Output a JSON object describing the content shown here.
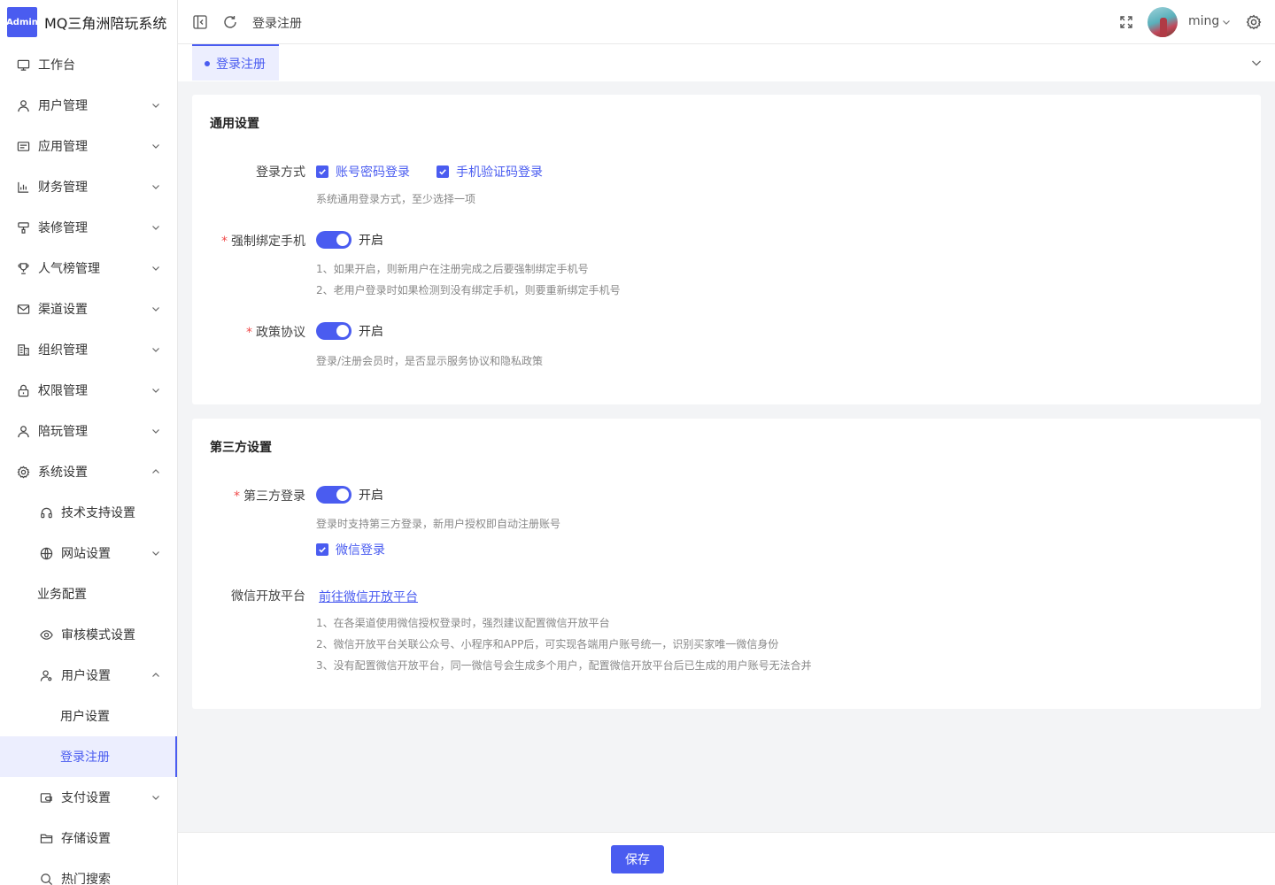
{
  "brand": {
    "logo_text": "Admin",
    "title": "MQ三角洲陪玩系统"
  },
  "sidebar": {
    "items": [
      {
        "label": "工作台",
        "icon": "monitor-icon"
      },
      {
        "label": "用户管理",
        "icon": "user-icon"
      },
      {
        "label": "应用管理",
        "icon": "app-icon"
      },
      {
        "label": "财务管理",
        "icon": "chart-icon"
      },
      {
        "label": "装修管理",
        "icon": "brush-icon"
      },
      {
        "label": "人气榜管理",
        "icon": "trophy-icon"
      },
      {
        "label": "渠道设置",
        "icon": "mail-icon"
      },
      {
        "label": "组织管理",
        "icon": "building-icon"
      },
      {
        "label": "权限管理",
        "icon": "lock-icon"
      },
      {
        "label": "陪玩管理",
        "icon": "user-icon"
      },
      {
        "label": "系统设置",
        "icon": "gear-icon"
      },
      {
        "label": "技术支持设置",
        "icon": "headset-icon"
      },
      {
        "label": "网站设置",
        "icon": "globe-icon"
      },
      {
        "label": "业务配置",
        "icon": ""
      },
      {
        "label": "审核模式设置",
        "icon": "eye-icon"
      },
      {
        "label": "用户设置",
        "icon": "user-settings-icon"
      },
      {
        "label": "用户设置"
      },
      {
        "label": "登录注册"
      },
      {
        "label": "支付设置",
        "icon": "payment-icon"
      },
      {
        "label": "存储设置",
        "icon": "folder-icon"
      },
      {
        "label": "热门搜索",
        "icon": "search-icon"
      }
    ]
  },
  "header": {
    "breadcrumb": "登录注册",
    "username": "ming"
  },
  "tabs": [
    {
      "label": "登录注册",
      "active": true
    }
  ],
  "general": {
    "title": "通用设置",
    "login_method": {
      "label": "登录方式",
      "options": [
        {
          "label": "账号密码登录",
          "checked": true
        },
        {
          "label": "手机验证码登录",
          "checked": true
        }
      ],
      "help": "系统通用登录方式，至少选择一项"
    },
    "bind_phone": {
      "required_mark": "*",
      "label": "强制绑定手机",
      "state": "开启",
      "help1": "1、如果开启，则新用户在注册完成之后要强制绑定手机号",
      "help2": "2、老用户登录时如果检测到没有绑定手机，则要重新绑定手机号"
    },
    "policy": {
      "required_mark": "*",
      "label": "政策协议",
      "state": "开启",
      "help": "登录/注册会员时，是否显示服务协议和隐私政策"
    }
  },
  "third_party": {
    "title": "第三方设置",
    "login": {
      "required_mark": "*",
      "label": "第三方登录",
      "state": "开启",
      "help": "登录时支持第三方登录，新用户授权即自动注册账号",
      "wechat_option": {
        "label": "微信登录",
        "checked": true
      }
    },
    "open_platform": {
      "label": "微信开放平台",
      "link": "前往微信开放平台",
      "help1": "1、在各渠道使用微信授权登录时，强烈建议配置微信开放平台",
      "help2": "2、微信开放平台关联公众号、小程序和APP后，可实现各端用户账号统一，识别买家唯一微信身份",
      "help3": "3、没有配置微信开放平台，同一微信号会生成多个用户，配置微信开放平台后已生成的用户账号无法合并"
    }
  },
  "footer": {
    "save_label": "保存"
  },
  "colors": {
    "accent": "#4a5cf0",
    "required": "#f04a4a",
    "content_bg": "#f3f4f6"
  }
}
